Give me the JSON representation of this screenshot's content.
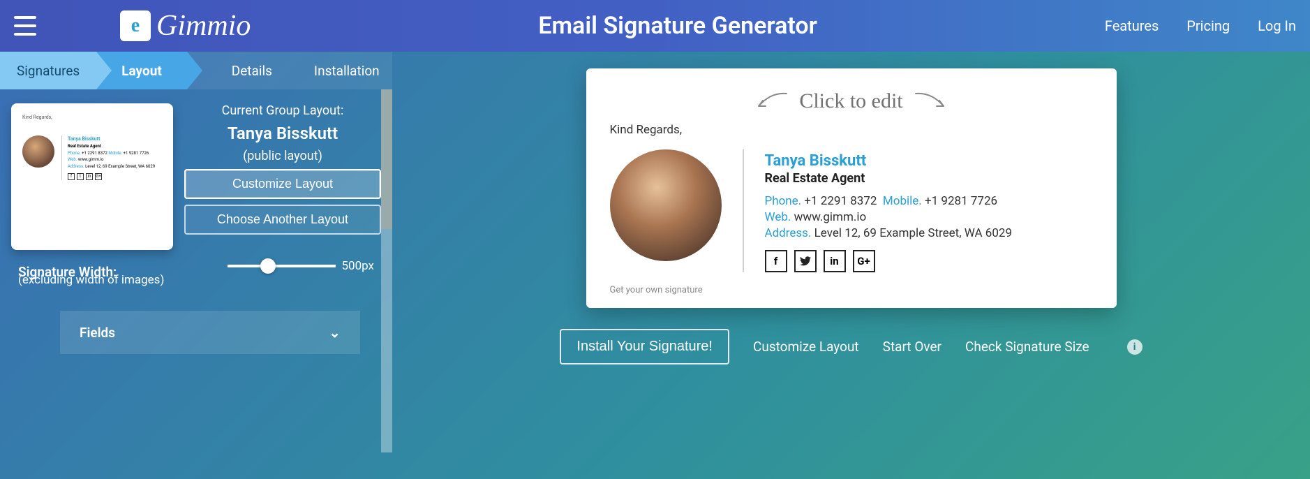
{
  "header": {
    "logo_text": "Gimmio",
    "title": "Email Signature Generator",
    "nav": [
      "Features",
      "Pricing",
      "Log In"
    ]
  },
  "tabs": {
    "signatures": "Signatures",
    "layout": "Layout",
    "details": "Details",
    "installation": "Installation"
  },
  "layout_panel": {
    "current_group_label": "Current Group Layout:",
    "name": "Tanya Bisskutt",
    "public": "(public layout)",
    "customize_btn": "Customize Layout",
    "choose_btn": "Choose Another Layout"
  },
  "thumb": {
    "greeting": "Kind Regards,",
    "name": "Tanya Bisskutt",
    "role": "Real Estate Agent",
    "phone_label": "Phone.",
    "phone": "+1 2291 8372",
    "mobile_label": "Mobile.",
    "mobile": "+1 9281 7726",
    "web_label": "Web.",
    "web": "www.gimm.io",
    "addr_label": "Address.",
    "addr": "Level 12, 69 Example Street, WA 6029"
  },
  "width_section": {
    "label": "Signature Width:",
    "sub": "(excluding width of images)",
    "value": "500px"
  },
  "fields_row": "Fields",
  "preview": {
    "click_to_edit": "Click to edit",
    "greeting": "Kind Regards,",
    "name": "Tanya Bisskutt",
    "role": "Real Estate Agent",
    "phone_label": "Phone.",
    "phone": "+1 2291 8372",
    "mobile_label": "Mobile.",
    "mobile": "+1 9281 7726",
    "web_label": "Web.",
    "web": "www.gimm.io",
    "addr_label": "Address.",
    "addr": "Level 12, 69 Example Street, WA 6029",
    "own_sig": "Get your own signature"
  },
  "actions": {
    "install": "Install Your Signature!",
    "customize": "Customize Layout",
    "start_over": "Start Over",
    "check_size": "Check Signature Size"
  }
}
